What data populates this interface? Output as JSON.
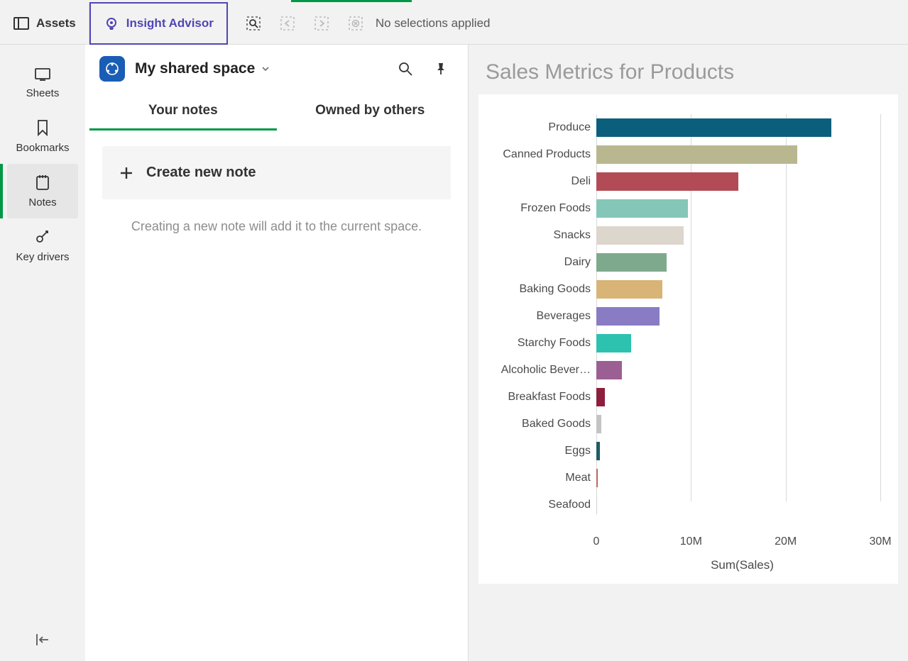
{
  "topbar": {
    "assets_label": "Assets",
    "insight_label": "Insight Advisor",
    "selections_text": "No selections applied"
  },
  "rail": {
    "items": [
      {
        "label": "Sheets"
      },
      {
        "label": "Bookmarks"
      },
      {
        "label": "Notes"
      },
      {
        "label": "Key drivers"
      }
    ]
  },
  "notes": {
    "space_name": "My shared space",
    "tabs": [
      "Your notes",
      "Owned by others"
    ],
    "create_label": "Create new note",
    "hint": "Creating a new note will add it to the current space."
  },
  "chart_title": "Sales Metrics for Products",
  "chart_data": {
    "type": "bar",
    "orientation": "horizontal",
    "xlabel": "Sum(Sales)",
    "ylabel": "",
    "xlim": [
      0,
      30000000
    ],
    "xticks": [
      {
        "value": 0,
        "label": "0"
      },
      {
        "value": 10000000,
        "label": "10M"
      },
      {
        "value": 20000000,
        "label": "20M"
      },
      {
        "value": 30000000,
        "label": "30M"
      }
    ],
    "categories": [
      "Produce",
      "Canned Products",
      "Deli",
      "Frozen Foods",
      "Snacks",
      "Dairy",
      "Baking Goods",
      "Beverages",
      "Starchy Foods",
      "Alcoholic Bever…",
      "Breakfast Foods",
      "Baked Goods",
      "Eggs",
      "Meat",
      "Seafood"
    ],
    "values": [
      24800000,
      21200000,
      15000000,
      9700000,
      9200000,
      7400000,
      7000000,
      6700000,
      3700000,
      2700000,
      900000,
      500000,
      400000,
      150000,
      80000
    ],
    "colors": [
      "#0b5f7d",
      "#b9b78f",
      "#b24b55",
      "#84c7b8",
      "#dcd6cc",
      "#7fa98d",
      "#d9b477",
      "#8a7cc4",
      "#2dc2b0",
      "#9c5f94",
      "#8d1f3c",
      "#c4c4c4",
      "#1f5d63",
      "#b9695b",
      "#d3d3d3"
    ]
  }
}
